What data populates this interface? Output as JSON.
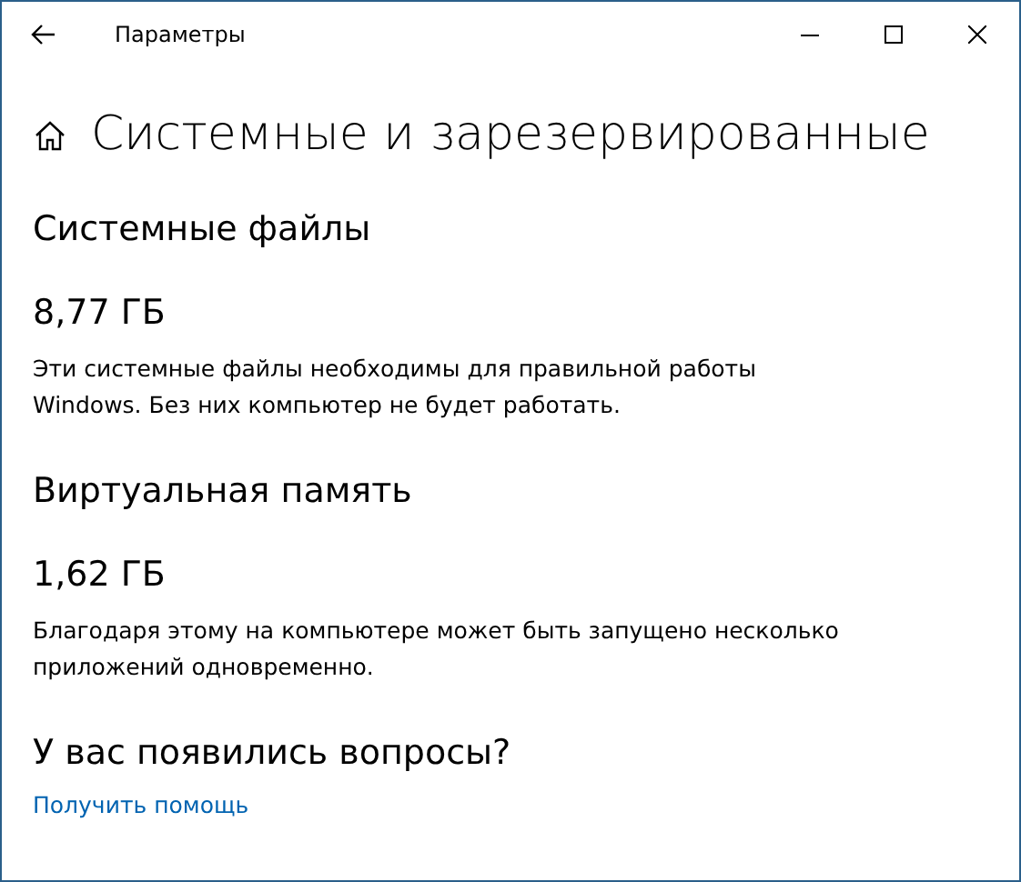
{
  "window": {
    "title": "Параметры"
  },
  "page": {
    "title": "Системные и зарезервированные"
  },
  "sections": [
    {
      "heading": "Системные файлы",
      "size": "8,77 ГБ",
      "description": "Эти системные файлы необходимы для правильной работы\nWindows. Без них компьютер не будет работать."
    },
    {
      "heading": "Виртуальная память",
      "size": "1,62 ГБ",
      "description": "Благодаря этому на компьютере может быть запущено несколько приложений одновременно."
    }
  ],
  "help": {
    "heading": "У вас появились вопросы?",
    "link": "Получить помощь"
  }
}
